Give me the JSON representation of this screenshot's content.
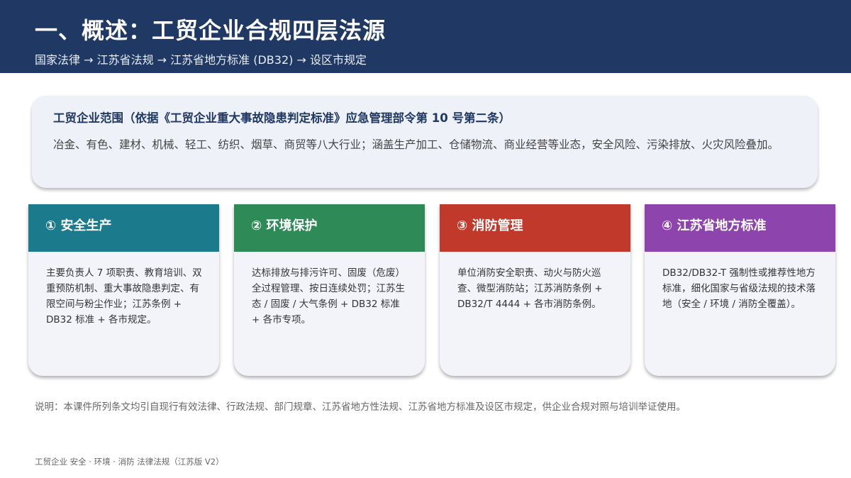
{
  "header": {
    "title": "一、概述：工贸企业合规四层法源",
    "subtitle": "国家法律 → 江苏省法规 → 江苏省地方标准 (DB32) → 设区市规定"
  },
  "scope": {
    "title": "工贸企业范围（依据《工贸企业重大事故隐患判定标准》应急管理部令第 10 号第二条）",
    "body": "冶金、有色、建材、机械、轻工、纺织、烟草、商贸等八大行业；涵盖生产加工、仓储物流、商业经营等业态，安全风险、污染排放、火灾风险叠加。"
  },
  "cards": [
    {
      "title": "① 安全生产",
      "color": "#1b7a8c",
      "body": "主要负责人 7 项职责、教育培训、双重预防机制、重大事故隐患判定、有限空间与粉尘作业；江苏条例 + DB32 标准 + 各市规定。"
    },
    {
      "title": "② 环境保护",
      "color": "#2e8b57",
      "body": "达标排放与排污许可、固废（危废）全过程管理、按日连续处罚；江苏生态 / 固废 / 大气条例 + DB32 标准 + 各市专项。"
    },
    {
      "title": "③ 消防管理",
      "color": "#c0392b",
      "body": "单位消防安全职责、动火与防火巡查、微型消防站；江苏消防条例 + DB32/T 4444 + 各市消防条例。"
    },
    {
      "title": "④ 江苏省地方标准",
      "color": "#8e44ad",
      "body": "DB32/DB32-T 强制性或推荐性地方标准，细化国家与省级法规的技术落地（安全 / 环境 / 消防全覆盖）。"
    }
  ],
  "note": "说明：本课件所列条文均引自现行有效法律、行政法规、部门规章、江苏省地方性法规、江苏省地方标准及设区市规定，供企业合规对照与培训举证使用。",
  "footer": "工贸企业 安全 · 环境 · 消防 法律法规（江苏版 V2）"
}
